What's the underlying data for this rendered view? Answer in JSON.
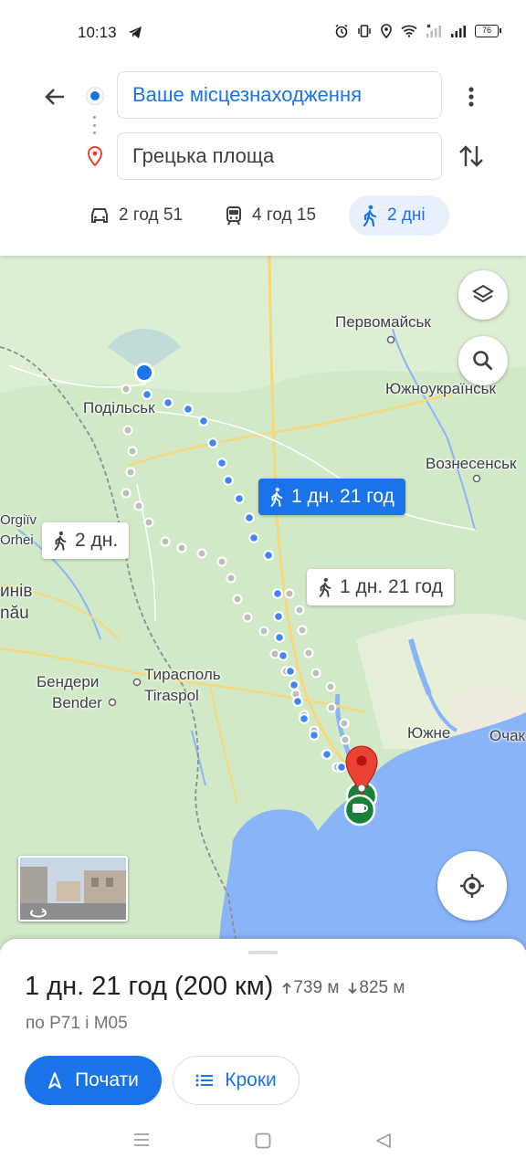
{
  "status_bar": {
    "time": "10:13",
    "battery": "76"
  },
  "directions": {
    "origin": "Ваше місцезнаходження",
    "destination": "Грецька площа"
  },
  "modes": {
    "car": "2 год 51",
    "transit": "4 год 15",
    "walk": "2 дні",
    "selected": "walk"
  },
  "map": {
    "labels": {
      "pervomaisk": "Первомайськ",
      "yuzhnoukrainsk": "Южноукраїнськ",
      "podilsk": "Подільськ",
      "voznesensk": "Вознесенськ",
      "orgiiv": "Orgiїv",
      "orhei": "Orhei",
      "kyshyniv": "инів",
      "chisinau": "nău",
      "bendery": "Бендери",
      "bender": "Bender",
      "tiraspol_ua": "Тирасполь",
      "tiraspol": "Tiraspol",
      "yuzhne": "Южне",
      "ochakiv": "Очак"
    },
    "callouts": {
      "route_main": "1 дн. 21 год",
      "route_alt1": "1 дн. 21 год",
      "route_alt2": "2 дн."
    },
    "colors": {
      "route": "#1a73e8",
      "alt_route": "#bdbdbd",
      "water": "#8ab4f8",
      "land": "#cfe8c5",
      "pin": "#ea4335"
    }
  },
  "summary": {
    "duration": "1 дн. 21 год (200 км)",
    "ascent": "739 м",
    "descent": "825 м",
    "via": "по Р71 і М05"
  },
  "actions": {
    "start": "Почати",
    "steps": "Кроки"
  }
}
